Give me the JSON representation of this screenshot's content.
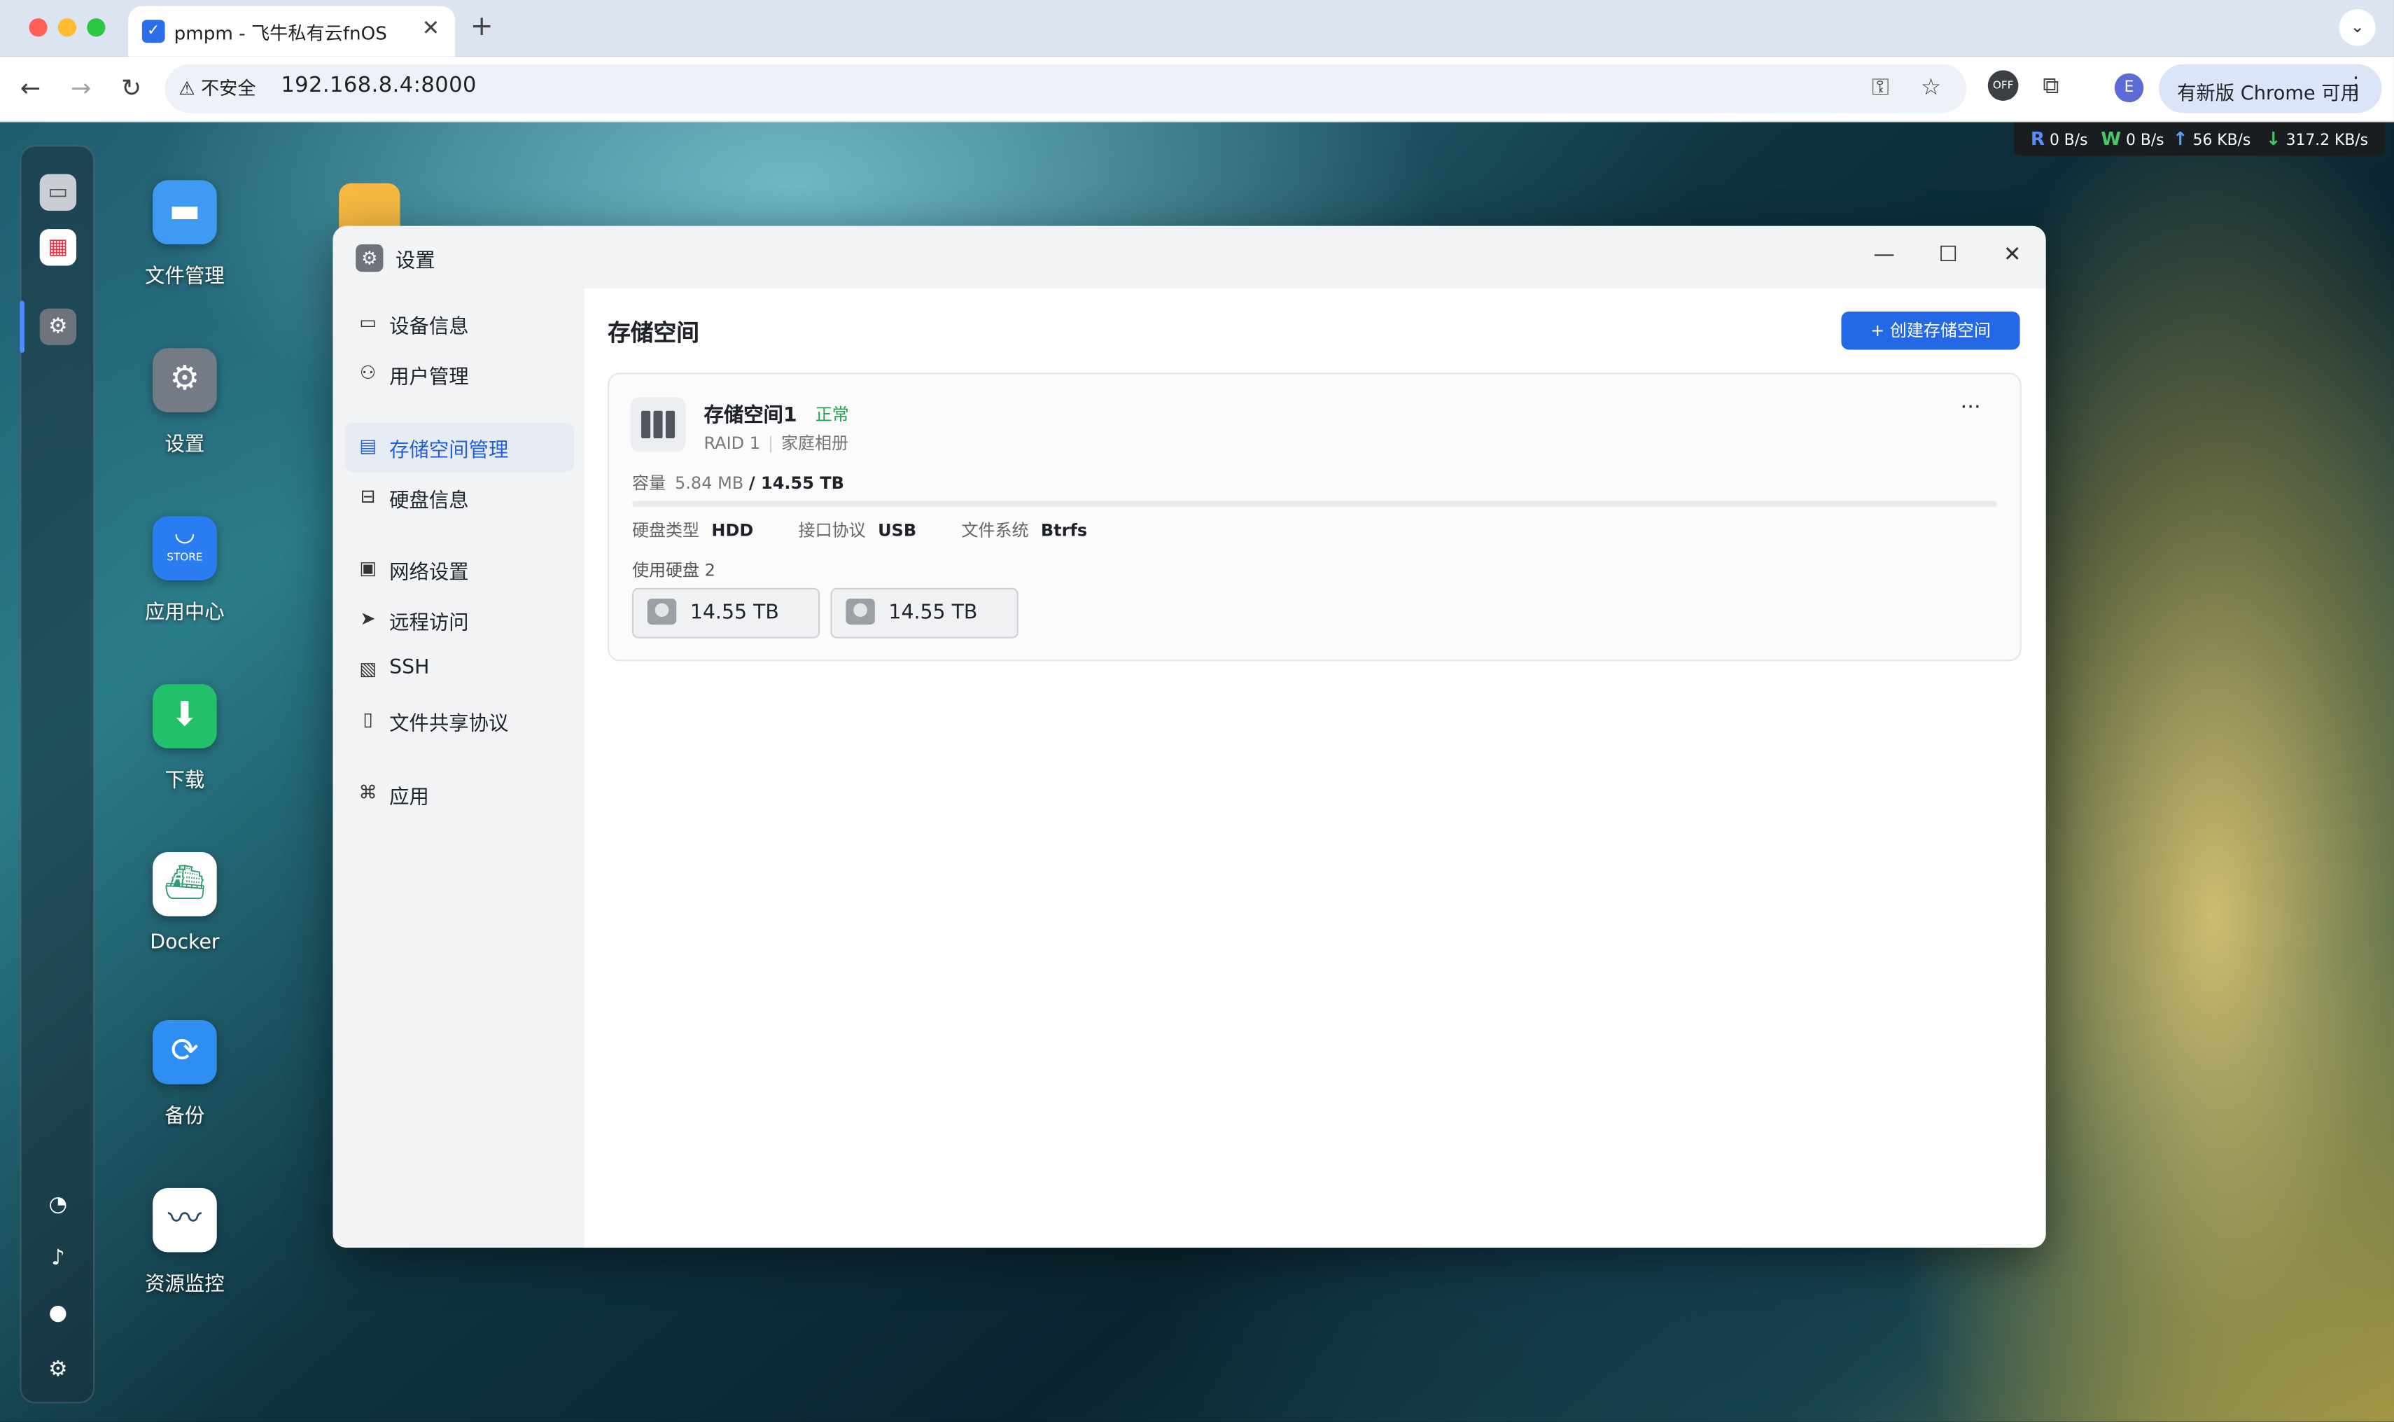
{
  "browser": {
    "tab_title": "pmpm - 飞牛私有云fnOS",
    "tab_close": "✕",
    "new_tab": "+",
    "tab_menu": "⌄",
    "security_label": "⚠ 不安全",
    "url": "192.168.8.4:8000",
    "profile_initial": "E",
    "update_label": "有新版 Chrome 可用",
    "update_menu": "⋮",
    "traffic_colors": [
      "#ff5f57",
      "#febc2e",
      "#28c840"
    ]
  },
  "speed_bar": {
    "read": "0 B/s",
    "write": "0 B/s",
    "upload": "56 KB/s",
    "download": "317.2 KB/s"
  },
  "desktop": {
    "apps": [
      {
        "label": "文件管理",
        "icon": "folder-icon",
        "color": "#3f9af2"
      },
      {
        "label": "设置",
        "icon": "gear-icon",
        "color": "#747b84"
      },
      {
        "label": "应用中心",
        "icon": "store-icon",
        "color": "#2a7df0",
        "badge": "STORE"
      },
      {
        "label": "下载",
        "icon": "download-icon",
        "color": "#22c06a"
      },
      {
        "label": "Docker",
        "icon": "docker-icon",
        "color": "#ffffff"
      },
      {
        "label": "备份",
        "icon": "backup-icon",
        "color": "#2f8ef2"
      },
      {
        "label": "资源监控",
        "icon": "monitor-icon",
        "color": "#ffffff"
      }
    ]
  },
  "window": {
    "title": "设置",
    "minimize": "—",
    "maximize": "☐",
    "close": "✕",
    "sidebar": [
      {
        "label": "设备信息",
        "icon": "device-icon",
        "glyph": "▭",
        "active": false
      },
      {
        "label": "用户管理",
        "icon": "user-icon",
        "glyph": "⚇",
        "active": false
      },
      {
        "label": "存储空间管理",
        "icon": "storage-icon",
        "glyph": "▤",
        "active": true
      },
      {
        "label": "硬盘信息",
        "icon": "disk-icon",
        "glyph": "⊟",
        "active": false
      },
      {
        "label": "网络设置",
        "icon": "network-icon",
        "glyph": "▣",
        "active": false
      },
      {
        "label": "远程访问",
        "icon": "send-icon",
        "glyph": "➤",
        "active": false
      },
      {
        "label": "SSH",
        "icon": "terminal-icon",
        "glyph": "▧",
        "active": false
      },
      {
        "label": "文件共享协议",
        "icon": "document-icon",
        "glyph": "▯",
        "active": false
      },
      {
        "label": "应用",
        "icon": "apps-icon",
        "glyph": "⌘",
        "active": false
      }
    ],
    "main": {
      "title": "存储空间",
      "create_button": "+  创建存储空间",
      "pool": {
        "name": "存储空间1",
        "status": "正常",
        "raid": "RAID 1",
        "label": "家庭相册",
        "more": "···",
        "capacity_label": "容量",
        "used": "5.84 MB",
        "total": "/ 14.55 TB",
        "used_fraction": 4e-07,
        "disk_type_label": "硬盘类型",
        "disk_type": "HDD",
        "interface_label": "接口协议",
        "interface": "USB",
        "fs_label": "文件系统",
        "fs": "Btrfs",
        "disks_label": "使用硬盘 2",
        "disks": [
          "14.55 TB",
          "14.55 TB"
        ]
      }
    }
  }
}
